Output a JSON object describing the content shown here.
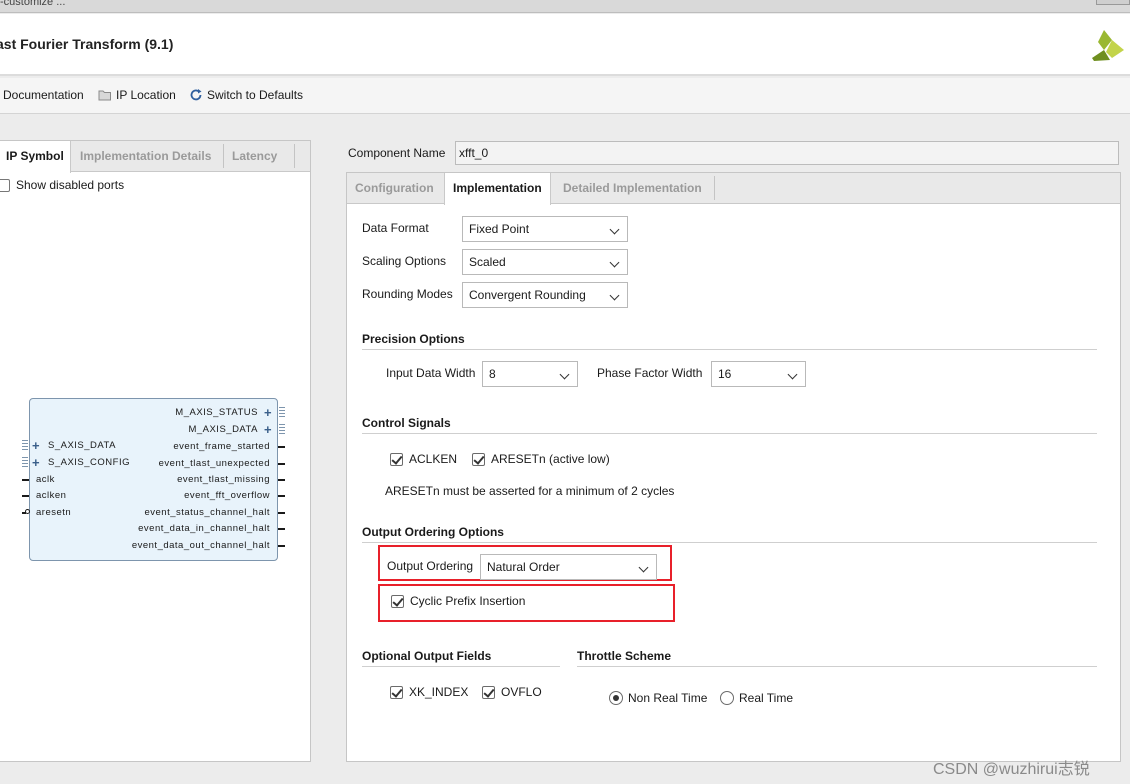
{
  "window": {
    "title_fragment": "-customize ..."
  },
  "header": {
    "title": "ast Fourier Transform (9.1)"
  },
  "toolbar": {
    "documentation": "Documentation",
    "ip_location": "IP Location",
    "switch_defaults": "Switch to Defaults"
  },
  "left_tabs": {
    "ip_symbol": "IP Symbol",
    "implementation_details": "Implementation Details",
    "latency": "Latency"
  },
  "show_disabled_ports": "Show disabled ports",
  "ip_symbol": {
    "right_ports": [
      "M_AXIS_STATUS",
      "M_AXIS_DATA",
      "event_frame_started",
      "event_tlast_unexpected",
      "event_tlast_missing",
      "event_fft_overflow",
      "event_status_channel_halt",
      "event_data_in_channel_halt",
      "event_data_out_channel_halt"
    ],
    "left_ports": [
      "S_AXIS_DATA",
      "S_AXIS_CONFIG",
      "aclk",
      "aclken",
      "aresetn"
    ]
  },
  "component": {
    "label": "Component Name",
    "value": "xfft_0"
  },
  "right_tabs": {
    "configuration": "Configuration",
    "implementation": "Implementation",
    "detailed_implementation": "Detailed Implementation"
  },
  "impl": {
    "data_format": {
      "label": "Data Format",
      "value": "Fixed Point"
    },
    "scaling_options": {
      "label": "Scaling Options",
      "value": "Scaled"
    },
    "rounding_modes": {
      "label": "Rounding Modes",
      "value": "Convergent Rounding"
    },
    "precision": {
      "title": "Precision Options",
      "input_width": {
        "label": "Input Data Width",
        "value": "8"
      },
      "phase_width": {
        "label": "Phase Factor Width",
        "value": "16"
      }
    },
    "control": {
      "title": "Control Signals",
      "aclken": {
        "label": "ACLKEN",
        "checked": true
      },
      "aresetn": {
        "label": "ARESETn (active low)",
        "checked": true
      },
      "note": "ARESETn must be asserted for a minimum of 2 cycles"
    },
    "output_ordering": {
      "title": "Output Ordering Options",
      "label": "Output Ordering",
      "value": "Natural Order",
      "cyclic_prefix": {
        "label": "Cyclic Prefix Insertion",
        "checked": true
      }
    },
    "optional_fields": {
      "title": "Optional Output Fields",
      "xk_index": {
        "label": "XK_INDEX",
        "checked": true
      },
      "ovflo": {
        "label": "OVFLO",
        "checked": true
      }
    },
    "throttle": {
      "title": "Throttle Scheme",
      "non_real_time": {
        "label": "Non Real Time",
        "selected": true
      },
      "real_time": {
        "label": "Real Time",
        "selected": false
      }
    }
  },
  "colors": {
    "highlight_box": "#e8202a",
    "symbol_fill": "#e8f3fb",
    "symbol_border": "#7d95ad",
    "logo_green": "#9ab832"
  },
  "watermark": "CSDN @wuzhirui志锐"
}
